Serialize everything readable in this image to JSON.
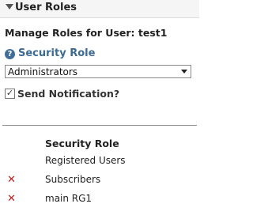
{
  "header": {
    "title": "User Roles"
  },
  "manage": {
    "title": "Manage Roles for User: test1"
  },
  "security_role": {
    "label": "Security Role",
    "selected": "Administrators"
  },
  "notification": {
    "label": "Send Notification?",
    "checked": true
  },
  "table": {
    "header": "Security Role",
    "rows": [
      {
        "name": "Registered Users",
        "deletable": false
      },
      {
        "name": "Subscribers",
        "deletable": true
      },
      {
        "name": "main RG1",
        "deletable": true
      }
    ]
  },
  "colors": {
    "link": "#3b6a93",
    "delete": "#cc1b1b"
  }
}
